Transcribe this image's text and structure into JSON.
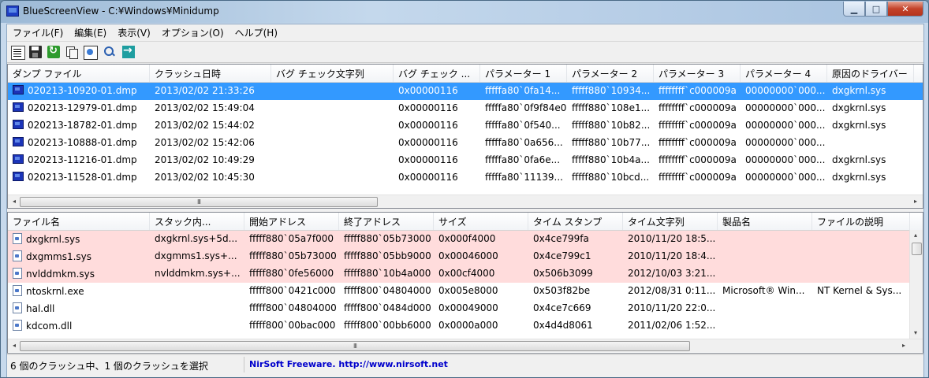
{
  "window": {
    "title_app": "BlueScreenView",
    "title_path": "C:¥Windows¥Minidump",
    "btn_min": "▁",
    "btn_max": "□",
    "btn_close": "✕"
  },
  "menu": [
    "ファイル(F)",
    "編集(E)",
    "表示(V)",
    "オプション(O)",
    "ヘルプ(H)"
  ],
  "toolbar": [
    "properties-icon",
    "save-icon",
    "refresh-icon",
    "copy-icon",
    "html-report-icon",
    "find-icon",
    "exit-icon"
  ],
  "upper": {
    "columns": [
      "ダンプ ファイル",
      "クラッシュ日時",
      "バグ チェック文字列",
      "バグ チェック ...",
      "パラメーター 1",
      "パラメーター 2",
      "パラメーター 3",
      "パラメーター 4",
      "原因のドライバー"
    ],
    "sort_arrow": "▽",
    "rows": [
      [
        "020213-10920-01.dmp",
        "2013/02/02 21:33:26",
        "",
        "0x00000116",
        "fffffa80`0fa14...",
        "fffff880`10934...",
        "ffffffff`c000009a",
        "00000000`000...",
        "dxgkrnl.sys"
      ],
      [
        "020213-12979-01.dmp",
        "2013/02/02 15:49:04",
        "",
        "0x00000116",
        "fffffa80`0f9f84e0",
        "fffff880`108e1...",
        "ffffffff`c000009a",
        "00000000`000...",
        "dxgkrnl.sys"
      ],
      [
        "020213-18782-01.dmp",
        "2013/02/02 15:44:02",
        "",
        "0x00000116",
        "fffffa80`0f540...",
        "fffff880`10b82...",
        "ffffffff`c000009a",
        "00000000`000...",
        "dxgkrnl.sys"
      ],
      [
        "020213-10888-01.dmp",
        "2013/02/02 15:42:06",
        "",
        "0x00000116",
        "fffffa80`0a656...",
        "fffff880`10b77...",
        "ffffffff`c000009a",
        "00000000`000...",
        ""
      ],
      [
        "020213-11216-01.dmp",
        "2013/02/02 10:49:29",
        "",
        "0x00000116",
        "fffffa80`0fa6e...",
        "fffff880`10b4a...",
        "ffffffff`c000009a",
        "00000000`000...",
        "dxgkrnl.sys"
      ],
      [
        "020213-11528-01.dmp",
        "2013/02/02 10:45:30",
        "",
        "0x00000116",
        "fffffa80`11139...",
        "fffff880`10bcd...",
        "ffffffff`c000009a",
        "00000000`000...",
        "dxgkrnl.sys"
      ]
    ],
    "selected_index": 0
  },
  "lower": {
    "columns": [
      "ファイル名",
      "スタック内...",
      "開始アドレス",
      "終了アドレス",
      "サイズ",
      "タイム スタンプ",
      "タイム文字列",
      "製品名",
      "ファイルの説明"
    ],
    "sort_arrow": "▽",
    "rows": [
      [
        "dxgkrnl.sys",
        "dxgkrnl.sys+5d...",
        "fffff880`05a7f000",
        "fffff880`05b73000",
        "0x000f4000",
        "0x4ce799fa",
        "2010/11/20 18:5...",
        "",
        ""
      ],
      [
        "dxgmms1.sys",
        "dxgmms1.sys+...",
        "fffff880`05b73000",
        "fffff880`05bb9000",
        "0x00046000",
        "0x4ce799c1",
        "2010/11/20 18:4...",
        "",
        ""
      ],
      [
        "nvlddmkm.sys",
        "nvlddmkm.sys+...",
        "fffff880`0fe56000",
        "fffff880`10b4a000",
        "0x00cf4000",
        "0x506b3099",
        "2012/10/03 3:21...",
        "",
        ""
      ],
      [
        "ntoskrnl.exe",
        "",
        "fffff800`0421c000",
        "fffff800`04804000",
        "0x005e8000",
        "0x503f82be",
        "2012/08/31 0:11...",
        "Microsoft® Win...",
        "NT Kernel & Sys..."
      ],
      [
        "hal.dll",
        "",
        "fffff800`04804000",
        "fffff800`0484d000",
        "0x00049000",
        "0x4ce7c669",
        "2010/11/20 22:0...",
        "",
        ""
      ],
      [
        "kdcom.dll",
        "",
        "fffff800`00bac000",
        "fffff800`00bb6000",
        "0x0000a000",
        "0x4d4d8061",
        "2011/02/06 1:52...",
        "",
        ""
      ]
    ],
    "highlight_count": 3
  },
  "scrollbar": {
    "grip": "III",
    "left": "◂",
    "right": "▸",
    "up": "▴",
    "down": "▾"
  },
  "status": {
    "left": "6 個のクラッシュ中、1 個のクラッシュを選択",
    "link": "NirSoft Freeware.  http://www.nirsoft.net"
  },
  "colors": {
    "selected": "#3399ff",
    "highlight": "#ffdcdc",
    "link": "#0000cc"
  }
}
